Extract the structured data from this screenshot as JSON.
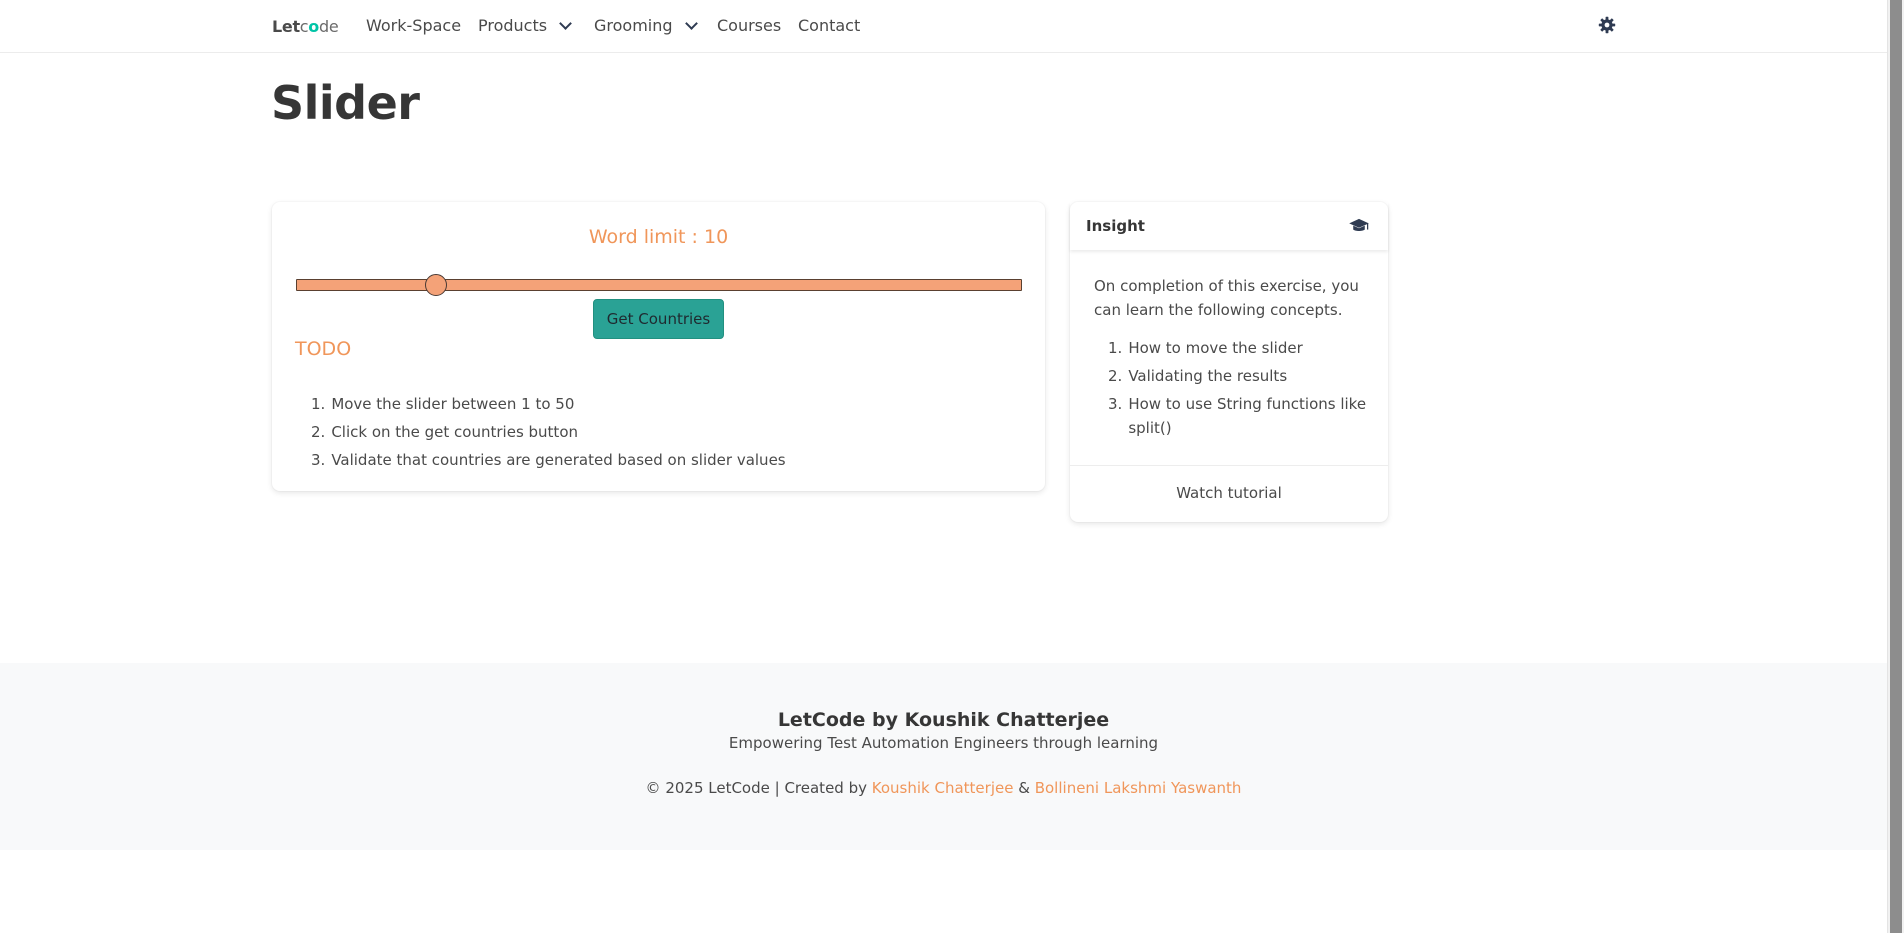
{
  "nav": {
    "brand_let": "Let",
    "brand_c": "c",
    "brand_o": "o",
    "brand_de": "de",
    "items": [
      {
        "label": "Work-Space"
      },
      {
        "label": "Products"
      },
      {
        "label": "Grooming"
      },
      {
        "label": "Courses"
      },
      {
        "label": "Contact"
      }
    ],
    "theme_icon": "gear-icon"
  },
  "page": {
    "title": "Slider"
  },
  "slider_card": {
    "word_limit": "Word limit : 10",
    "slider_value": 10,
    "slider_min": 1,
    "slider_max": 50,
    "button_label": "Get Countries",
    "todo_title": "TODO",
    "todo_items": [
      {
        "num": "1.",
        "text": "Move the slider between 1 to 50"
      },
      {
        "num": "2.",
        "text": "Click on the get countries button"
      },
      {
        "num": "3.",
        "text": "Validate that countries are generated based on slider values"
      }
    ]
  },
  "insight": {
    "title": "Insight",
    "icon": "graduation-cap-icon",
    "intro": "On completion of this exercise, you can learn the following concepts.",
    "items": [
      {
        "num": "1.",
        "text": "How to move the slider"
      },
      {
        "num": "2.",
        "text": "Validating the results"
      },
      {
        "num": "3.",
        "text": "How to use String functions like split()"
      }
    ],
    "watch_label": "Watch tutorial"
  },
  "footer": {
    "title": "LetCode by Koushik Chatterjee",
    "tagline": "Empowering Test Automation Engineers through learning",
    "copy_prefix": "© 2025 LetCode | Created by",
    "author1": "Koushik Chatterjee",
    "amp": "&",
    "author2": "Bollineni Lakshmi Yaswanth"
  },
  "colors": {
    "accent_orange": "#f0965a",
    "slider_fill": "#f4a278",
    "button_teal": "#2aa295",
    "brand_dot": "#00c4a7"
  }
}
